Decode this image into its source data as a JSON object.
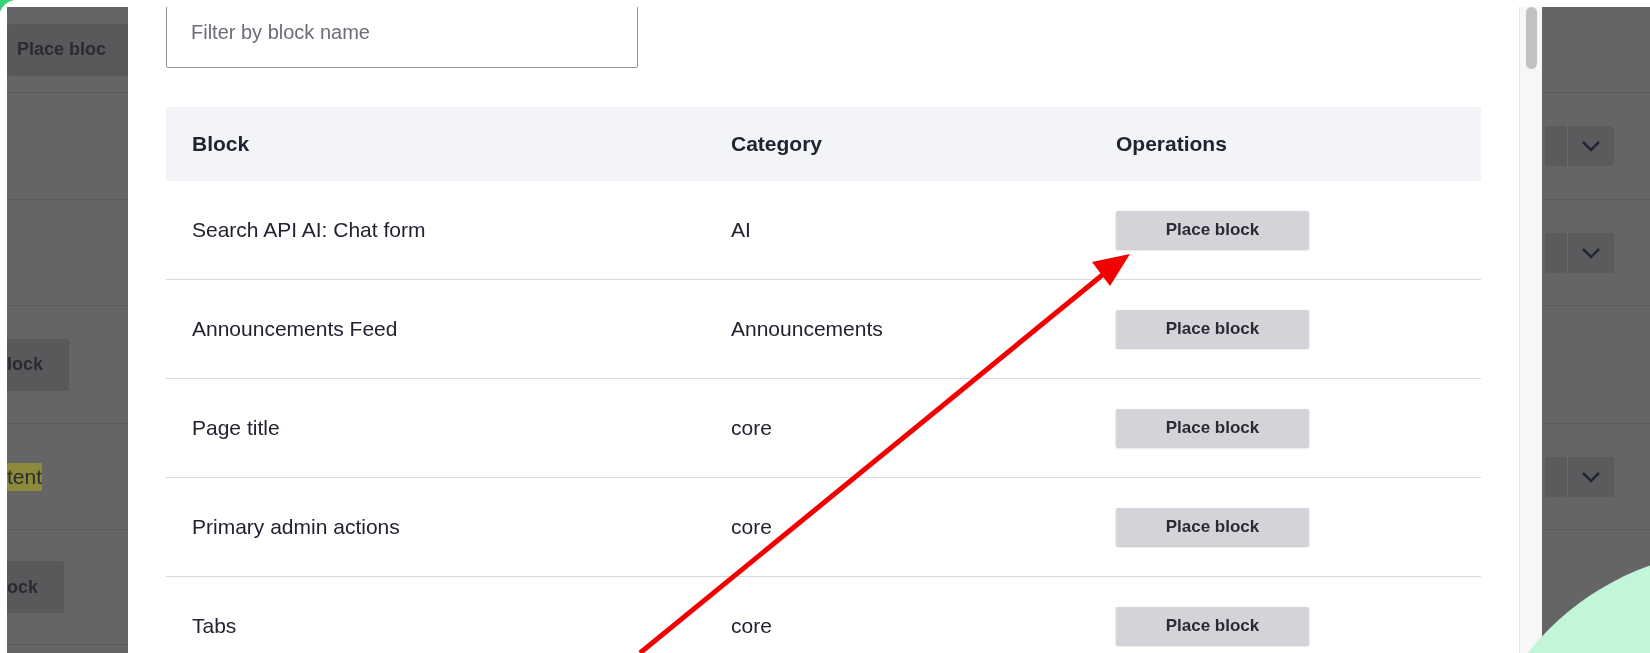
{
  "background_page": {
    "rows": [
      {
        "left": {
          "kind": "button",
          "label": "Place bloc"
        },
        "right": null
      },
      {
        "left": null,
        "right": {
          "kind": "split_button"
        }
      },
      {
        "left": null,
        "right": {
          "kind": "split_button"
        }
      },
      {
        "left": {
          "kind": "button",
          "label": "lock"
        },
        "right": null
      },
      {
        "left": {
          "kind": "highlight",
          "label": "tent"
        },
        "right": {
          "kind": "split_button"
        }
      },
      {
        "left": {
          "kind": "button",
          "label": "ock"
        },
        "right": null
      }
    ]
  },
  "dialog": {
    "filter": {
      "placeholder": "Filter by block name"
    },
    "table": {
      "columns": [
        "Block",
        "Category",
        "Operations"
      ],
      "rows": [
        {
          "block": "Search API AI: Chat form",
          "category": "AI",
          "operation": "Place block"
        },
        {
          "block": "Announcements Feed",
          "category": "Announcements",
          "operation": "Place block"
        },
        {
          "block": "Page title",
          "category": "core",
          "operation": "Place block"
        },
        {
          "block": "Primary admin actions",
          "category": "core",
          "operation": "Place block"
        },
        {
          "block": "Tabs",
          "category": "core",
          "operation": "Place block"
        }
      ]
    }
  }
}
